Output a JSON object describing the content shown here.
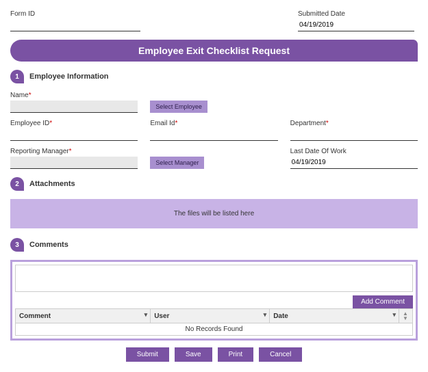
{
  "top": {
    "form_id_label": "Form ID",
    "form_id_value": "",
    "submitted_label": "Submitted Date",
    "submitted_value": "04/19/2019"
  },
  "banner": "Employee Exit Checklist Request",
  "section1": {
    "num": "1",
    "title": "Employee Information"
  },
  "fields": {
    "name_label": "Name",
    "name_value": "",
    "select_employee": "Select Employee",
    "emp_id_label": "Employee ID",
    "emp_id_value": "",
    "email_label": "Email Id",
    "email_value": "",
    "dept_label": "Department",
    "dept_value": "",
    "mgr_label": "Reporting Manager",
    "mgr_value": "",
    "select_manager": "Select Manager",
    "last_date_label": "Last Date Of Work",
    "last_date_value": "04/19/2019"
  },
  "section2": {
    "num": "2",
    "title": "Attachments"
  },
  "attach_msg": "The files will be listed here",
  "section3": {
    "num": "3",
    "title": "Comments"
  },
  "comments": {
    "add_btn": "Add Comment",
    "col_comment": "Comment",
    "col_user": "User",
    "col_date": "Date",
    "no_records": "No Records Found"
  },
  "footer": {
    "submit": "Submit",
    "save": "Save",
    "print": "Print",
    "cancel": "Cancel"
  }
}
